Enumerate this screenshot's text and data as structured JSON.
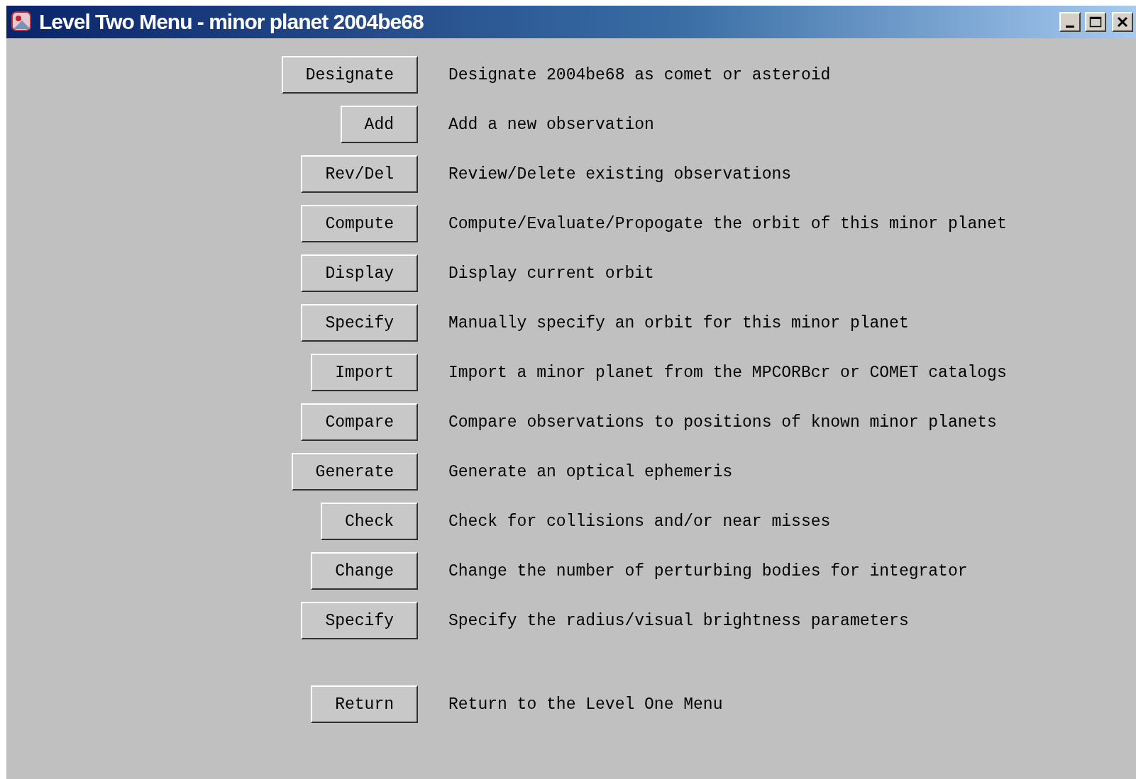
{
  "window": {
    "title": "Level Two Menu - minor planet 2004be68"
  },
  "commands": [
    {
      "button": "Designate",
      "description": "Designate 2004be68 as comet or asteroid"
    },
    {
      "button": "Add",
      "description": "Add a new observation"
    },
    {
      "button": "Rev/Del",
      "description": "Review/Delete existing observations"
    },
    {
      "button": "Compute",
      "description": "Compute/Evaluate/Propogate the orbit of this minor planet"
    },
    {
      "button": "Display",
      "description": "Display current orbit"
    },
    {
      "button": "Specify",
      "description": "Manually specify an orbit for this minor planet"
    },
    {
      "button": "Import",
      "description": "Import a minor planet from the MPCORBcr or COMET catalogs"
    },
    {
      "button": "Compare",
      "description": "Compare observations to positions of known minor planets"
    },
    {
      "button": "Generate",
      "description": "Generate an optical ephemeris"
    },
    {
      "button": "Check",
      "description": "Check for collisions and/or near misses"
    },
    {
      "button": "Change",
      "description": "Change the number of perturbing bodies for integrator"
    },
    {
      "button": "Specify",
      "description": "Specify the radius/visual brightness parameters"
    }
  ],
  "return_command": {
    "button": "Return",
    "description": "Return to the Level One Menu"
  }
}
